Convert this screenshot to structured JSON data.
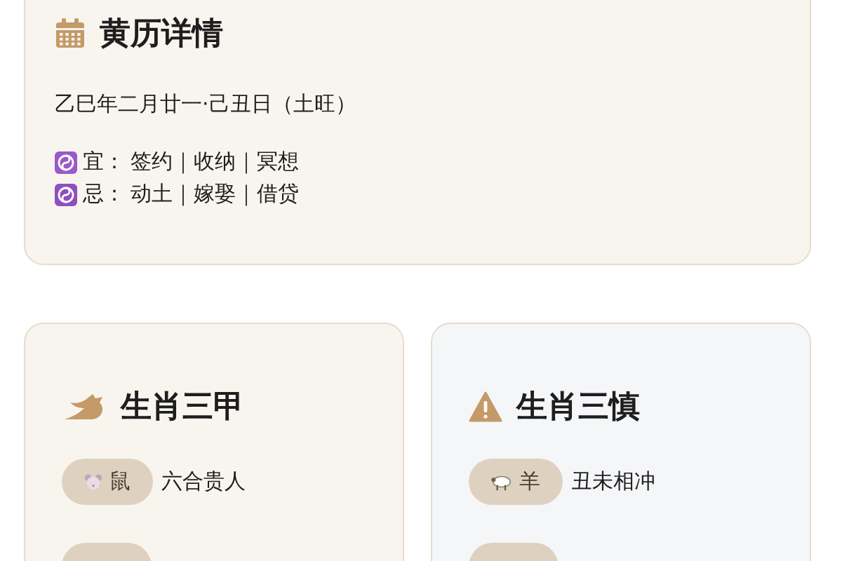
{
  "almanac": {
    "title": "黄历详情",
    "date": "乙巳年二月廿一·己丑日（土旺）",
    "entries": [
      {
        "kind": "good",
        "label": "宜：",
        "items": "签约｜收纳｜冥想"
      },
      {
        "kind": "bad",
        "label": "忌：",
        "items": "动土｜嫁娶｜借贷"
      }
    ]
  },
  "cards": [
    {
      "kind": "lucky",
      "title": "生肖三甲",
      "tags": [
        {
          "kind": "rat",
          "label": "鼠",
          "note": "六合贵人"
        }
      ]
    },
    {
      "kind": "caution",
      "title": "生肖三慎",
      "tags": [
        {
          "kind": "sheep",
          "label": "羊",
          "note": "丑未相冲"
        }
      ]
    }
  ]
}
